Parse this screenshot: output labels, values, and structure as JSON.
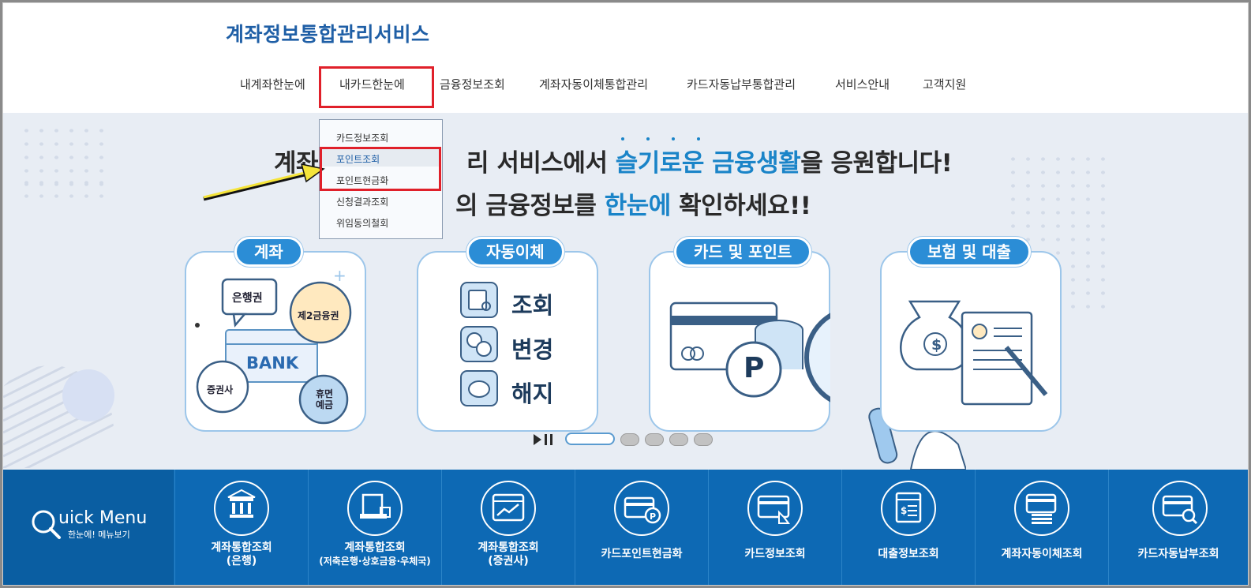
{
  "header": {
    "site_title": "계좌정보통합관리서비스",
    "nav": [
      {
        "label": "내계좌한눈에"
      },
      {
        "label": "내카드한눈에"
      },
      {
        "label": "금융정보조회"
      },
      {
        "label": "계좌자동이체통합관리"
      },
      {
        "label": "카드자동납부통합관리"
      },
      {
        "label": "서비스안내"
      },
      {
        "label": "고객지원"
      }
    ]
  },
  "dropdown": {
    "items": [
      {
        "label": "카드정보조회"
      },
      {
        "label": "포인트조회"
      },
      {
        "label": "포인트현금화"
      },
      {
        "label": "신청결과조회"
      },
      {
        "label": "위임동의철회"
      }
    ]
  },
  "hero": {
    "line1_a": "계좌",
    "line1_b": "리 서비스에서 ",
    "line1_accent": "슬기로운 금융생활",
    "line1_c": "을 응원합니다!",
    "line2_a": "의 금융정보를 ",
    "line2_accent": "한눈에",
    "line2_b": " 확인하세요!!",
    "cards": [
      {
        "label": "계좌",
        "bubbles": [
          "은행권",
          "제2금융권",
          "BANK",
          "증권사",
          "휴면예금"
        ]
      },
      {
        "label": "자동이체",
        "actions": [
          "조회",
          "변경",
          "해지"
        ]
      },
      {
        "label": "카드 및 포인트",
        "badge": "P"
      },
      {
        "label": "보험 및 대출",
        "badge": "$"
      }
    ],
    "slider": {
      "page_count": 5,
      "active_index": 0
    }
  },
  "quick_menu": {
    "title": "uick Menu",
    "subtitle": "한눈에! 메뉴보기",
    "items": [
      {
        "line1": "계좌통합조회",
        "line2": "(은행)",
        "icon": "bank-icon"
      },
      {
        "line1": "계좌통합조회",
        "line2": "(저축은행·상호금융·우체국)",
        "icon": "atm-icon"
      },
      {
        "line1": "계좌통합조회",
        "line2": "(증권사)",
        "icon": "stock-chart-icon"
      },
      {
        "line1": "카드포인트현금화",
        "line2": "",
        "icon": "card-point-icon"
      },
      {
        "line1": "카드정보조회",
        "line2": "",
        "icon": "card-touch-icon"
      },
      {
        "line1": "대출정보조회",
        "line2": "",
        "icon": "loan-document-icon"
      },
      {
        "line1": "계좌자동이체조회",
        "line2": "",
        "icon": "auto-transfer-icon"
      },
      {
        "line1": "카드자동납부조회",
        "line2": "",
        "icon": "card-search-icon"
      }
    ]
  },
  "colors": {
    "brand": "#1f5fa6",
    "accent": "#1a84c8",
    "quick_bg": "#0d69b4",
    "highlight": "#e0202a"
  }
}
